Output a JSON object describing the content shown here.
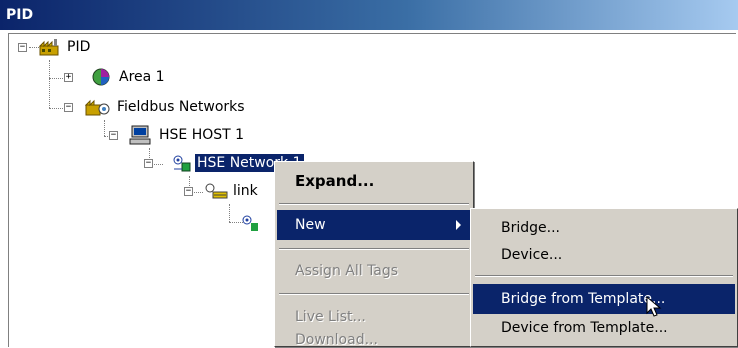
{
  "window": {
    "title": "PID"
  },
  "tree": {
    "root": "PID",
    "area1": "Area 1",
    "fieldbus": "Fieldbus Networks",
    "host": "HSE HOST 1",
    "network": "HSE Network 1",
    "link": "link"
  },
  "context_menu": {
    "expand": "Expand...",
    "new": "New",
    "assign": "Assign All Tags",
    "livelist": "Live List...",
    "download": "Download..."
  },
  "submenu": {
    "bridge": "Bridge...",
    "device": "Device...",
    "bridge_template": "Bridge from Template...",
    "device_template": "Device from Template..."
  },
  "colors": {
    "selection": "#0a246a",
    "menu_bg": "#d4d0c8"
  }
}
